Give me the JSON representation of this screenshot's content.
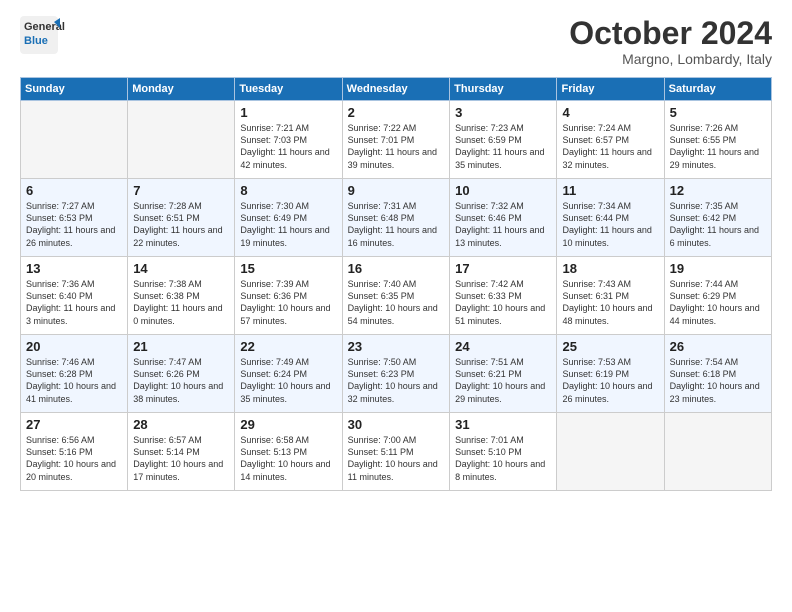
{
  "header": {
    "logo_line1": "General",
    "logo_line2": "Blue",
    "month": "October 2024",
    "location": "Margno, Lombardy, Italy"
  },
  "weekdays": [
    "Sunday",
    "Monday",
    "Tuesday",
    "Wednesday",
    "Thursday",
    "Friday",
    "Saturday"
  ],
  "weeks": [
    [
      {
        "day": "",
        "empty": true
      },
      {
        "day": "",
        "empty": true
      },
      {
        "day": "1",
        "sunrise": "7:21 AM",
        "sunset": "7:03 PM",
        "daylight": "11 hours and 42 minutes."
      },
      {
        "day": "2",
        "sunrise": "7:22 AM",
        "sunset": "7:01 PM",
        "daylight": "11 hours and 39 minutes."
      },
      {
        "day": "3",
        "sunrise": "7:23 AM",
        "sunset": "6:59 PM",
        "daylight": "11 hours and 35 minutes."
      },
      {
        "day": "4",
        "sunrise": "7:24 AM",
        "sunset": "6:57 PM",
        "daylight": "11 hours and 32 minutes."
      },
      {
        "day": "5",
        "sunrise": "7:26 AM",
        "sunset": "6:55 PM",
        "daylight": "11 hours and 29 minutes."
      }
    ],
    [
      {
        "day": "6",
        "sunrise": "7:27 AM",
        "sunset": "6:53 PM",
        "daylight": "11 hours and 26 minutes."
      },
      {
        "day": "7",
        "sunrise": "7:28 AM",
        "sunset": "6:51 PM",
        "daylight": "11 hours and 22 minutes."
      },
      {
        "day": "8",
        "sunrise": "7:30 AM",
        "sunset": "6:49 PM",
        "daylight": "11 hours and 19 minutes."
      },
      {
        "day": "9",
        "sunrise": "7:31 AM",
        "sunset": "6:48 PM",
        "daylight": "11 hours and 16 minutes."
      },
      {
        "day": "10",
        "sunrise": "7:32 AM",
        "sunset": "6:46 PM",
        "daylight": "11 hours and 13 minutes."
      },
      {
        "day": "11",
        "sunrise": "7:34 AM",
        "sunset": "6:44 PM",
        "daylight": "11 hours and 10 minutes."
      },
      {
        "day": "12",
        "sunrise": "7:35 AM",
        "sunset": "6:42 PM",
        "daylight": "11 hours and 6 minutes."
      }
    ],
    [
      {
        "day": "13",
        "sunrise": "7:36 AM",
        "sunset": "6:40 PM",
        "daylight": "11 hours and 3 minutes."
      },
      {
        "day": "14",
        "sunrise": "7:38 AM",
        "sunset": "6:38 PM",
        "daylight": "11 hours and 0 minutes."
      },
      {
        "day": "15",
        "sunrise": "7:39 AM",
        "sunset": "6:36 PM",
        "daylight": "10 hours and 57 minutes."
      },
      {
        "day": "16",
        "sunrise": "7:40 AM",
        "sunset": "6:35 PM",
        "daylight": "10 hours and 54 minutes."
      },
      {
        "day": "17",
        "sunrise": "7:42 AM",
        "sunset": "6:33 PM",
        "daylight": "10 hours and 51 minutes."
      },
      {
        "day": "18",
        "sunrise": "7:43 AM",
        "sunset": "6:31 PM",
        "daylight": "10 hours and 48 minutes."
      },
      {
        "day": "19",
        "sunrise": "7:44 AM",
        "sunset": "6:29 PM",
        "daylight": "10 hours and 44 minutes."
      }
    ],
    [
      {
        "day": "20",
        "sunrise": "7:46 AM",
        "sunset": "6:28 PM",
        "daylight": "10 hours and 41 minutes."
      },
      {
        "day": "21",
        "sunrise": "7:47 AM",
        "sunset": "6:26 PM",
        "daylight": "10 hours and 38 minutes."
      },
      {
        "day": "22",
        "sunrise": "7:49 AM",
        "sunset": "6:24 PM",
        "daylight": "10 hours and 35 minutes."
      },
      {
        "day": "23",
        "sunrise": "7:50 AM",
        "sunset": "6:23 PM",
        "daylight": "10 hours and 32 minutes."
      },
      {
        "day": "24",
        "sunrise": "7:51 AM",
        "sunset": "6:21 PM",
        "daylight": "10 hours and 29 minutes."
      },
      {
        "day": "25",
        "sunrise": "7:53 AM",
        "sunset": "6:19 PM",
        "daylight": "10 hours and 26 minutes."
      },
      {
        "day": "26",
        "sunrise": "7:54 AM",
        "sunset": "6:18 PM",
        "daylight": "10 hours and 23 minutes."
      }
    ],
    [
      {
        "day": "27",
        "sunrise": "6:56 AM",
        "sunset": "5:16 PM",
        "daylight": "10 hours and 20 minutes."
      },
      {
        "day": "28",
        "sunrise": "6:57 AM",
        "sunset": "5:14 PM",
        "daylight": "10 hours and 17 minutes."
      },
      {
        "day": "29",
        "sunrise": "6:58 AM",
        "sunset": "5:13 PM",
        "daylight": "10 hours and 14 minutes."
      },
      {
        "day": "30",
        "sunrise": "7:00 AM",
        "sunset": "5:11 PM",
        "daylight": "10 hours and 11 minutes."
      },
      {
        "day": "31",
        "sunrise": "7:01 AM",
        "sunset": "5:10 PM",
        "daylight": "10 hours and 8 minutes."
      },
      {
        "day": "",
        "empty": true
      },
      {
        "day": "",
        "empty": true
      }
    ]
  ]
}
